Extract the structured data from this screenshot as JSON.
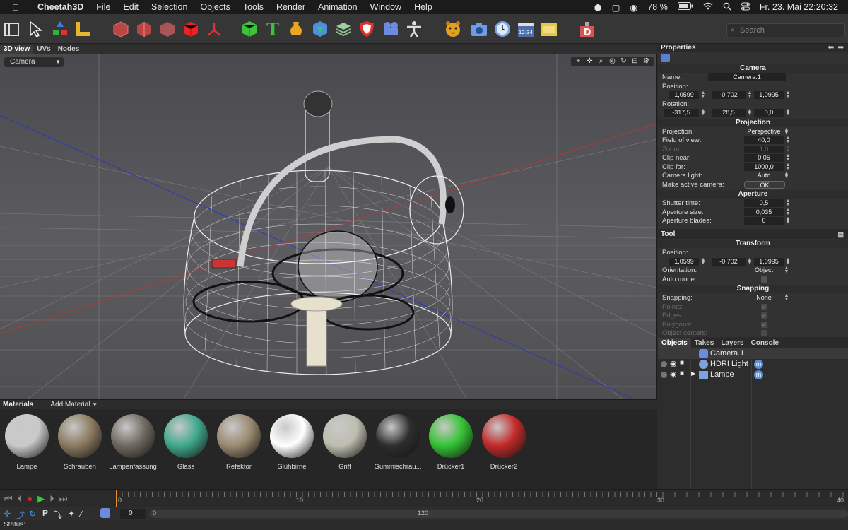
{
  "menubar": {
    "app": "Cheetah3D",
    "items": [
      "File",
      "Edit",
      "Selection",
      "Objects",
      "Tools",
      "Render",
      "Animation",
      "Window",
      "Help"
    ],
    "battery": "78 %",
    "datetime": "Fr. 23. Mai  22:20:32"
  },
  "toolbar": {
    "search_placeholder": "Search",
    "tools": [
      "panel-toggle-icon",
      "arrow-select-icon",
      "move-tool-icon",
      "ruler-icon",
      "box-wire-1-icon",
      "box-wire-2-icon",
      "box-solid-gray-icon",
      "box-red-icon",
      "axis-icon",
      "cube-green-icon",
      "text-t-icon",
      "vase-icon",
      "shape-hex-icon",
      "layers-icon",
      "shield-icon",
      "camera-people-icon",
      "figure-icon",
      "cheetah-icon",
      "camera-icon",
      "clock-icon",
      "clapper-icon",
      "folder-icon",
      "render-d-icon"
    ]
  },
  "viewport": {
    "tabs": [
      "3D view",
      "UVs",
      "Nodes"
    ],
    "camera_select": "Camera"
  },
  "properties": {
    "title": "Properties",
    "camera_section": "Camera",
    "name_label": "Name:",
    "name_value": "Camera.1",
    "position_label": "Position:",
    "position": [
      "1,0599",
      "-0,702",
      "1,0995"
    ],
    "rotation_label": "Rotation:",
    "rotation": [
      "-317,5",
      "28,5",
      "0,0"
    ],
    "projection_section": "Projection",
    "projection_label": "Projection:",
    "projection_value": "Perspective",
    "fov_label": "Field of view:",
    "fov_value": "40,0",
    "zoom_label": "Zoom:",
    "zoom_value": "1,0",
    "clip_near_label": "Clip near:",
    "clip_near_value": "0,05",
    "clip_far_label": "Clip far:",
    "clip_far_value": "1000,0",
    "camera_light_label": "Camera light:",
    "camera_light_value": "Auto",
    "make_active_label": "Make active camera:",
    "make_active_button": "OK",
    "aperture_section": "Aperture",
    "shutter_label": "Shutter time:",
    "shutter_value": "0,5",
    "aperture_size_label": "Aperture size:",
    "aperture_size_value": "0,035",
    "aperture_blades_label": "Aperture blades:",
    "aperture_blades_value": "0"
  },
  "tool": {
    "title": "Tool",
    "transform_section": "Transform",
    "position_label": "Position:",
    "position": [
      "1,0599",
      "-0,702",
      "1,0995"
    ],
    "orientation_label": "Orientation:",
    "orientation_value": "Object",
    "auto_mode_label": "Auto mode:",
    "snapping_section": "Snapping",
    "snapping_label": "Snapping:",
    "snapping_value": "None",
    "points_label": "Points:",
    "edges_label": "Edges:",
    "polygons_label": "Polygons:",
    "object_centers_label": "Object centers:"
  },
  "objects": {
    "tabs": [
      "Objects",
      "Takes",
      "Layers",
      "Console"
    ],
    "rows": [
      {
        "name": "Camera.1",
        "icon": "camera-object-icon"
      },
      {
        "name": "HDRI Light",
        "icon": "light-object-icon"
      },
      {
        "name": "Lampe",
        "icon": "folder-object-icon"
      }
    ]
  },
  "materials": {
    "title": "Materials",
    "add_label": "Add Material",
    "items": [
      {
        "name": "Lampe",
        "color": "#c9c9c9"
      },
      {
        "name": "Schrauben",
        "color": "#8a7a60"
      },
      {
        "name": "Lampenfassung",
        "color": "#6f6a60"
      },
      {
        "name": "Glass",
        "color": "#3fa88c"
      },
      {
        "name": "Refektor",
        "color": "#9a8a70"
      },
      {
        "name": "Glühbirne",
        "color": "#ffffff"
      },
      {
        "name": "Griff",
        "color": "#bdbdb0"
      },
      {
        "name": "Gummischrau...",
        "color": "#2e2e2e"
      },
      {
        "name": "Drücker1",
        "color": "#33c233"
      },
      {
        "name": "Drücker2",
        "color": "#c22a2a"
      }
    ]
  },
  "timeline": {
    "labels": [
      "0",
      "10",
      "20",
      "30",
      "40"
    ],
    "frame": "0",
    "range_start": "0",
    "range_end": "120"
  },
  "status": {
    "label": "Status:"
  }
}
